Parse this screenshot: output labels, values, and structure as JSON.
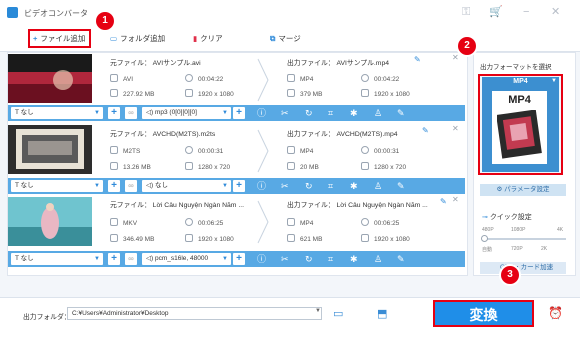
{
  "app": {
    "title": "ビデオコンバータ"
  },
  "toolbar": {
    "add_file": "ファイル追加",
    "add_folder": "フォルダ追加",
    "clear": "クリア",
    "merge": "マージ"
  },
  "badges": [
    "1",
    "2",
    "3"
  ],
  "files": [
    {
      "source_name": "元ファイル： AVIサンプル.avi",
      "source_format": "AVI",
      "source_duration": "00:04:22",
      "source_size": "227.92 MB",
      "source_resolution": "1920 x 1080",
      "output_name": "出力ファイル： AVIサンプル.mp4",
      "output_format": "MP4",
      "output_duration": "00:04:22",
      "output_size": "379 MB",
      "output_resolution": "1920 x 1080",
      "subtitle": "なし",
      "audio": "mp3 (0[0][0][0]",
      "thumb_colors": [
        "#b0273c",
        "#1a1a1a",
        "#6b1020"
      ]
    },
    {
      "source_name": "元ファイル： AVCHD(M2TS).m2ts",
      "source_format": "M2TS",
      "source_duration": "00:00:31",
      "source_size": "13.26 MB",
      "source_resolution": "1280 x 720",
      "output_name": "出力ファイル： AVCHD(M2TS).mp4",
      "output_format": "MP4",
      "output_duration": "00:00:31",
      "output_size": "20 MB",
      "output_resolution": "1280 x 720",
      "subtitle": "なし",
      "audio": "なし",
      "thumb_colors": [
        "#2d2d2d",
        "#e8e2d6",
        "#5a5a5a"
      ]
    },
    {
      "source_name": "元ファイル： Lời Câu Nguyện Ngàn Năm ...",
      "source_format": "MKV",
      "source_duration": "00:06:25",
      "source_size": "346.49 MB",
      "source_resolution": "1920 x 1080",
      "output_name": "出力ファイル： Lời Câu Nguyện Ngàn Năm ...",
      "output_format": "MP4",
      "output_duration": "00:06:25",
      "output_size": "621 MB",
      "output_resolution": "1920 x 1080",
      "subtitle": "なし",
      "audio": "pcm_s16le, 48000",
      "thumb_colors": [
        "#6fc4cf",
        "#e9b7c3",
        "#3a8f9a"
      ]
    }
  ],
  "right_panel": {
    "title": "出力フォーマットを選択",
    "format_selected": "MP4",
    "format_icon_text": "MP4",
    "param_settings": "パラメータ設定",
    "quick_settings": "クイック設定",
    "quality_top": [
      "480P",
      "1080P",
      "4K"
    ],
    "quality_bottom": [
      "自動",
      "720P",
      "2K"
    ],
    "gpu_accel": "GPU・カード加速"
  },
  "bottom": {
    "output_folder_label": "出力フォルダ：",
    "output_path": "C:¥Users¥Administrator¥Desktop",
    "convert_label": "変換"
  },
  "colors": {
    "accent": "#1f8ee8",
    "highlight": "#e60012",
    "control_bar": "#58a9e4"
  }
}
